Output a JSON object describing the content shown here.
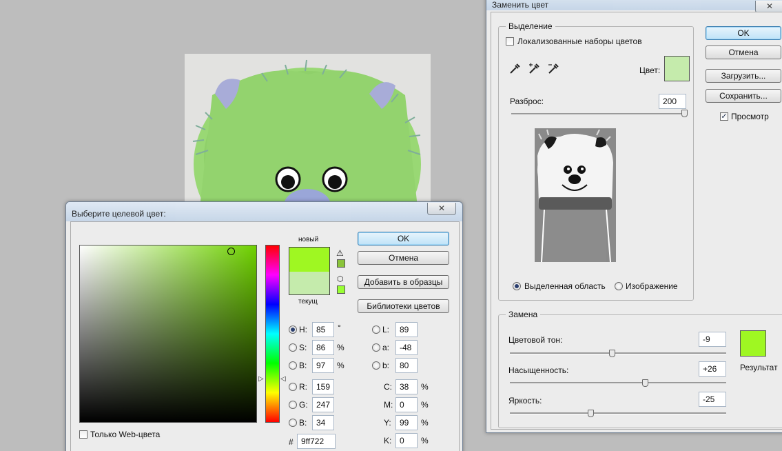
{
  "colors": {
    "new": "#9ff722",
    "current": "#c5ebac",
    "result": "#9ff722",
    "preview": "#c5ebac"
  },
  "picker": {
    "title": "Выберите целевой цвет:",
    "close_icon": "close-icon",
    "new_label": "новый",
    "current_label": "текущ",
    "ok": "OK",
    "cancel": "Отмена",
    "add_to_swatches": "Добавить в образцы",
    "color_libraries": "Библиотеки цветов",
    "web_only": "Только Web-цвета",
    "h": {
      "label": "H:",
      "value": "85",
      "unit": "°"
    },
    "s": {
      "label": "S:",
      "value": "86",
      "unit": "%"
    },
    "b": {
      "label": "B:",
      "value": "97",
      "unit": "%"
    },
    "r": {
      "label": "R:",
      "value": "159"
    },
    "g": {
      "label": "G:",
      "value": "247"
    },
    "bl": {
      "label": "B:",
      "value": "34"
    },
    "l": {
      "label": "L:",
      "value": "89"
    },
    "a": {
      "label": "a:",
      "value": "-48"
    },
    "lb": {
      "label": "b:",
      "value": "80"
    },
    "c": {
      "label": "C:",
      "value": "38",
      "unit": "%"
    },
    "m": {
      "label": "M:",
      "value": "0",
      "unit": "%"
    },
    "y": {
      "label": "Y:",
      "value": "99",
      "unit": "%"
    },
    "k": {
      "label": "K:",
      "value": "0",
      "unit": "%"
    },
    "hash": "#",
    "hex": "9ff722",
    "gamut_warning_icon": "warning-icon",
    "web_cube_icon": "cube-icon"
  },
  "replace": {
    "title": "Заменить цвет",
    "close_icon": "close-icon",
    "selection_group": "Выделение",
    "localized": "Локализованные наборы цветов",
    "color_label": "Цвет:",
    "fuzziness_label": "Разброс:",
    "fuzziness_value": "200",
    "fuzziness_fraction": 1.0,
    "selection_radio": "Выделенная область",
    "image_radio": "Изображение",
    "ok": "OK",
    "cancel": "Отмена",
    "load": "Загрузить...",
    "save": "Сохранить...",
    "preview": "Просмотр",
    "replacement_group": "Замена",
    "hue_label": "Цветовой тон:",
    "hue_value": "-9",
    "saturation_label": "Насыщенность:",
    "saturation_value": "+26",
    "lightness_label": "Яркость:",
    "lightness_value": "-25",
    "result_label": "Результат",
    "eyedropper_icons": [
      "eyedropper-icon",
      "eyedropper-plus-icon",
      "eyedropper-minus-icon"
    ]
  }
}
